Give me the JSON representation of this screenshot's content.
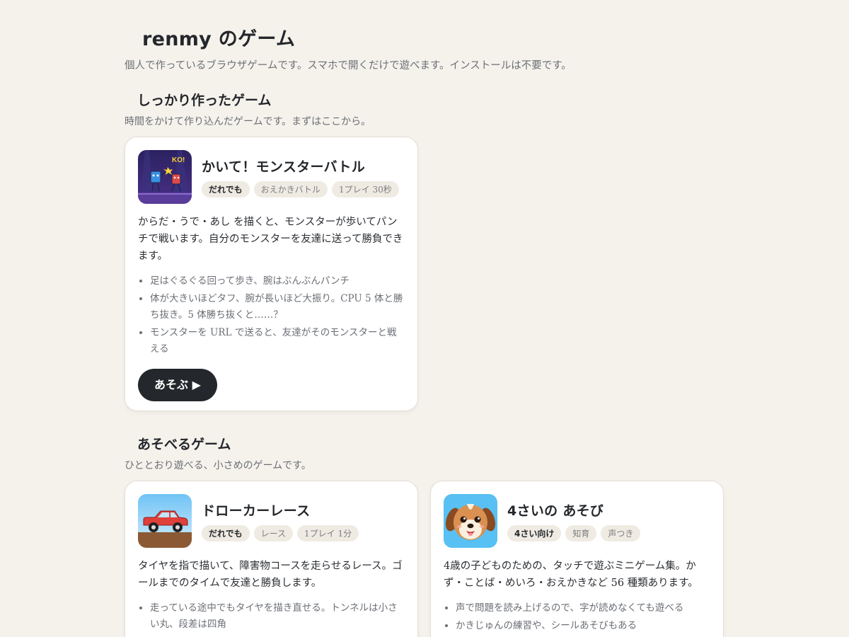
{
  "header": {
    "title": "renmy のゲーム",
    "description": "個人で作っているブラウザゲームです。スマホで開くだけで遊べます。インストールは不要です。"
  },
  "featured": {
    "title": "しっかり作ったゲーム",
    "description": "時間をかけて作り込んだゲームです。まずはここから。",
    "games": [
      {
        "title": "かいて！モンスターバトル",
        "thumb_icon": "monster-battle-icon",
        "thumb_text": "KO!",
        "tags": [
          "だれでも",
          "おえかきバトル",
          "1プレイ 30秒"
        ],
        "description": "からだ・うで・あし を描くと、モンスターが歩いてパンチで戦います。自分のモンスターを友達に送って勝負できます。",
        "features": [
          "足はぐるぐる回って歩き、腕はぶんぶんパンチ",
          "体が大きいほどタフ、腕が長いほど大振り。CPU 5 体と勝ち抜き。5 体勝ち抜くと……？",
          "モンスターを URL で送ると、友達がそのモンスターと戦える"
        ],
        "play_label": "あそぶ ▶"
      }
    ]
  },
  "casual": {
    "title": "あそべるゲーム",
    "description": "ひととおり遊べる、小さめのゲームです。",
    "games": [
      {
        "title": "ドローカーレース",
        "thumb_icon": "red-car-icon",
        "tags": [
          "だれでも",
          "レース",
          "1プレイ 1分"
        ],
        "description": "タイヤを指で描いて、障害物コースを走らせるレース。ゴールまでのタイムで友達と勝負します。",
        "features": [
          "走っている途中でもタイヤを描き直せる。トンネルは小さい丸、段差は四角"
        ]
      },
      {
        "title": "4さいの あそび",
        "thumb_icon": "puppy-icon",
        "tags": [
          "4さい向け",
          "知育",
          "声つき"
        ],
        "description": "4歳の子どものための、タッチで遊ぶミニゲーム集。かず・ことば・めいろ・おえかきなど 56 種類あります。",
        "features": [
          "声で問題を読み上げるので、字が読めなくても遊べる",
          "かきじゅんの練習や、シールあそびもある"
        ]
      }
    ]
  },
  "colors": {
    "background": "#f5f2ec",
    "card": "#ffffff",
    "tag_bg": "#efebe3",
    "button": "#24272b",
    "button_text": "#ffffff"
  }
}
